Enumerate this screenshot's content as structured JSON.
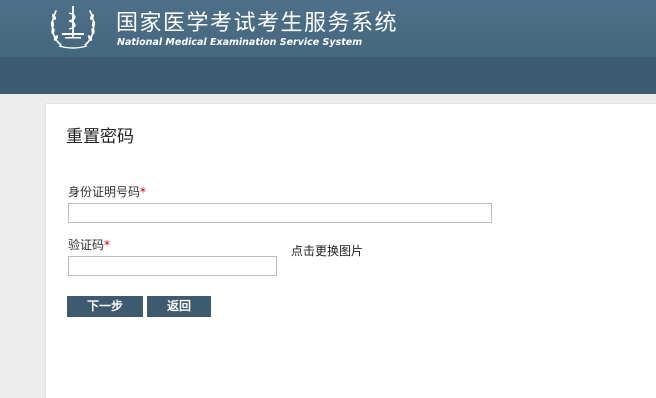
{
  "header": {
    "title_cn": "国家医学考试考生服务系统",
    "title_en": "National Medical Examination Service System",
    "colors": {
      "header_bg": "#4e7088",
      "header_band": "#3d5b70"
    }
  },
  "form": {
    "title": "重置密码",
    "id_label": "身份证明号码",
    "id_value": "",
    "required_mark": "*",
    "captcha_label": "验证码",
    "captcha_value": "",
    "refresh_image_link": "点击更换图片",
    "next_button": "下一步",
    "back_button": "返回",
    "colors": {
      "button_bg": "#3e5a6e",
      "required": "#d00000"
    }
  }
}
